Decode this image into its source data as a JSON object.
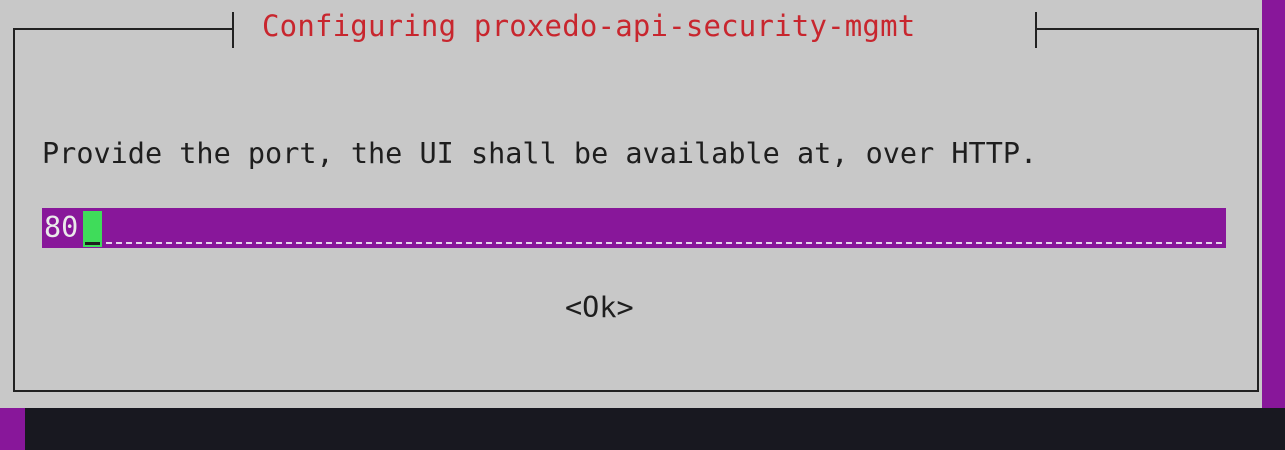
{
  "dialog": {
    "title": "Configuring proxedo-api-security-mgmt",
    "prompt": "Provide the port, the UI shall be available at, over HTTP.",
    "input": {
      "value": "80"
    },
    "ok_label": "<Ok>"
  },
  "colors": {
    "background": "#88179a",
    "dialog_bg": "#c8c8c8",
    "title_red": "#c8262e",
    "cursor_green": "#3fdc5a",
    "shadow": "#181820"
  }
}
